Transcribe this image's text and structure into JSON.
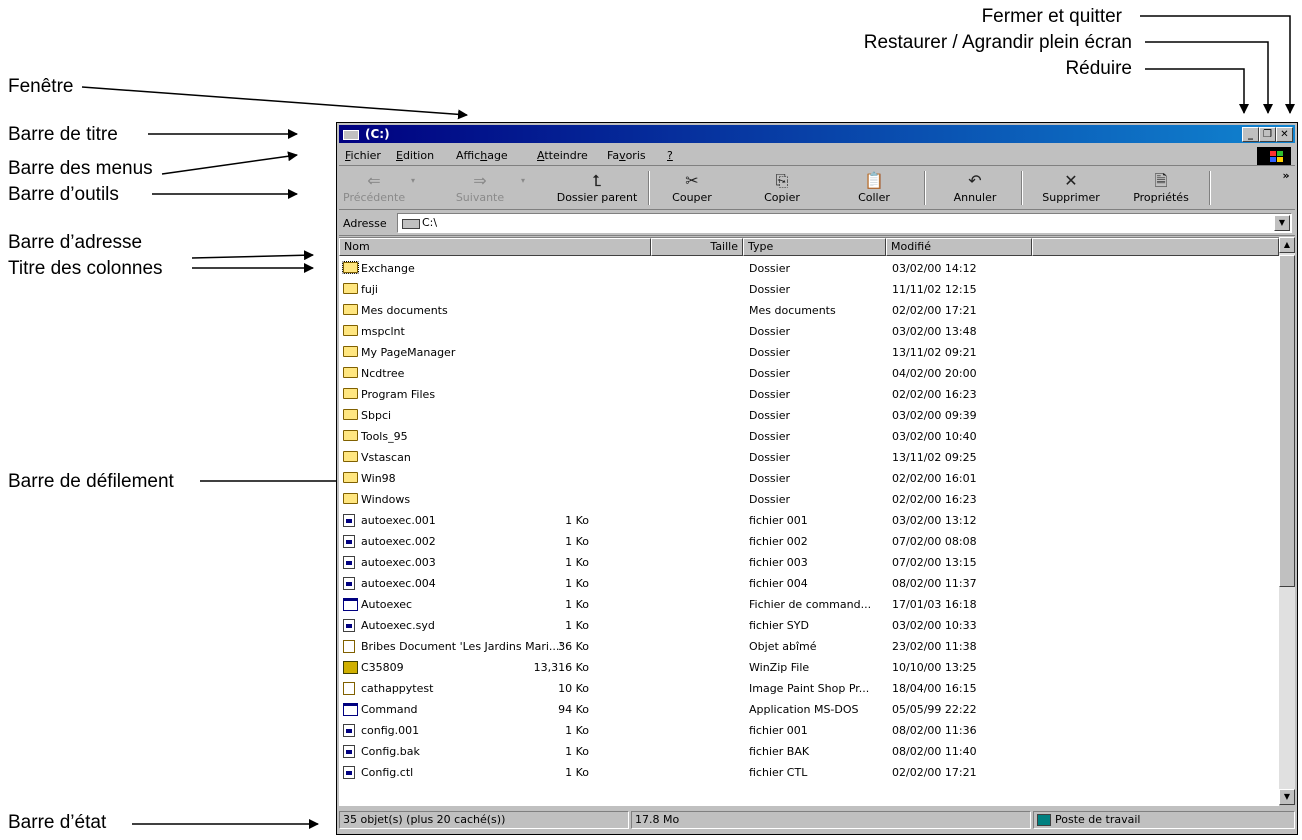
{
  "callouts": {
    "fenetre": "Fenêtre",
    "titre": "Barre de titre",
    "menus": "Barre des menus",
    "outils": "Barre d’outils",
    "adresse": "Barre d’adresse",
    "colonnes": "Titre des colonnes",
    "defilement": "Barre de défilement",
    "etat": "Barre d’état",
    "fermer": "Fermer et quitter",
    "restaurer": "Restaurer / Agrandir plein écran",
    "reduire": "Réduire"
  },
  "window": {
    "title": "(C:)",
    "menus": [
      {
        "pre": "",
        "key": "F",
        "post": "ichier"
      },
      {
        "pre": "",
        "key": "E",
        "post": "dition"
      },
      {
        "pre": "Affic",
        "key": "h",
        "post": "age"
      },
      {
        "pre": "",
        "key": "A",
        "post": "tteindre"
      },
      {
        "pre": "Fa",
        "key": "v",
        "post": "oris"
      },
      {
        "pre": "",
        "key": "?",
        "post": ""
      }
    ],
    "toolbar": {
      "back": "Précédente",
      "forward": "Suivante",
      "up": "Dossier parent",
      "cut": "Couper",
      "copy": "Copier",
      "paste": "Coller",
      "undo": "Annuler",
      "delete": "Supprimer",
      "properties": "Propriétés",
      "more": "»"
    },
    "address": {
      "label": "Adresse",
      "value": "C:\\"
    },
    "columns": {
      "name": "Nom",
      "size": "Taille",
      "type": "Type",
      "modified": "Modifié"
    },
    "rows": [
      {
        "icon": "folder",
        "name": "Exchange",
        "size": "",
        "type": "Dossier",
        "modified": "03/02/00 14:12"
      },
      {
        "icon": "folder",
        "name": "fuji",
        "size": "",
        "type": "Dossier",
        "modified": "11/11/02 12:15"
      },
      {
        "icon": "folder",
        "name": "Mes documents",
        "size": "",
        "type": "Mes documents",
        "modified": "02/02/00 17:21"
      },
      {
        "icon": "folder",
        "name": "mspclnt",
        "size": "",
        "type": "Dossier",
        "modified": "03/02/00 13:48"
      },
      {
        "icon": "folder",
        "name": "My PageManager",
        "size": "",
        "type": "Dossier",
        "modified": "13/11/02 09:21"
      },
      {
        "icon": "folder",
        "name": "Ncdtree",
        "size": "",
        "type": "Dossier",
        "modified": "04/02/00 20:00"
      },
      {
        "icon": "folder",
        "name": "Program Files",
        "size": "",
        "type": "Dossier",
        "modified": "02/02/00 16:23"
      },
      {
        "icon": "folder",
        "name": "Sbpci",
        "size": "",
        "type": "Dossier",
        "modified": "03/02/00 09:39"
      },
      {
        "icon": "folder",
        "name": "Tools_95",
        "size": "",
        "type": "Dossier",
        "modified": "03/02/00 10:40"
      },
      {
        "icon": "folder",
        "name": "Vstascan",
        "size": "",
        "type": "Dossier",
        "modified": "13/11/02 09:25"
      },
      {
        "icon": "folder",
        "name": "Win98",
        "size": "",
        "type": "Dossier",
        "modified": "02/02/00 16:01"
      },
      {
        "icon": "folder",
        "name": "Windows",
        "size": "",
        "type": "Dossier",
        "modified": "02/02/00 16:23"
      },
      {
        "icon": "file",
        "name": "autoexec.001",
        "size": "1 Ko",
        "type": "fichier 001",
        "modified": "03/02/00 13:12"
      },
      {
        "icon": "file",
        "name": "autoexec.002",
        "size": "1 Ko",
        "type": "fichier 002",
        "modified": "07/02/00 08:08"
      },
      {
        "icon": "file",
        "name": "autoexec.003",
        "size": "1 Ko",
        "type": "fichier 003",
        "modified": "07/02/00 13:15"
      },
      {
        "icon": "file",
        "name": "autoexec.004",
        "size": "1 Ko",
        "type": "fichier 004",
        "modified": "08/02/00 11:37"
      },
      {
        "icon": "app",
        "name": "Autoexec",
        "size": "1 Ko",
        "type": "Fichier de command...",
        "modified": "17/01/03 16:18"
      },
      {
        "icon": "file",
        "name": "Autoexec.syd",
        "size": "1 Ko",
        "type": "fichier SYD",
        "modified": "03/02/00 10:33"
      },
      {
        "icon": "doc",
        "name": "Bribes Document 'Les Jardins Mari...'",
        "size": "36 Ko",
        "type": "Objet abîmé",
        "modified": "23/02/00 11:38"
      },
      {
        "icon": "zip",
        "name": "C35809",
        "size": "13,316 Ko",
        "type": "WinZip File",
        "modified": "10/10/00 13:25"
      },
      {
        "icon": "doc",
        "name": "cathappytest",
        "size": "10 Ko",
        "type": "Image Paint Shop Pr...",
        "modified": "18/04/00 16:15"
      },
      {
        "icon": "app",
        "name": "Command",
        "size": "94 Ko",
        "type": "Application MS-DOS",
        "modified": "05/05/99 22:22"
      },
      {
        "icon": "file",
        "name": "config.001",
        "size": "1 Ko",
        "type": "fichier 001",
        "modified": "08/02/00 11:36"
      },
      {
        "icon": "file",
        "name": "Config.bak",
        "size": "1 Ko",
        "type": "fichier BAK",
        "modified": "08/02/00 11:40"
      },
      {
        "icon": "file",
        "name": "Config.ctl",
        "size": "1 Ko",
        "type": "fichier CTL",
        "modified": "02/02/00 17:21"
      }
    ],
    "status": {
      "objects": "35 objet(s) (plus 20 caché(s))",
      "size": "17.8 Mo",
      "zone": "Poste de travail"
    }
  }
}
